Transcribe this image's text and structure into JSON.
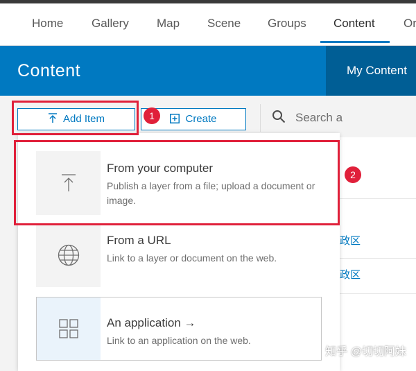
{
  "topnav": {
    "items": [
      {
        "label": "Home"
      },
      {
        "label": "Gallery"
      },
      {
        "label": "Map"
      },
      {
        "label": "Scene"
      },
      {
        "label": "Groups"
      },
      {
        "label": "Content",
        "active": true
      },
      {
        "label": "Or"
      }
    ]
  },
  "banner": {
    "title": "Content",
    "tab": "My Content"
  },
  "toolbar": {
    "add_item": "Add Item",
    "create": "Create",
    "search_placeholder": "Search a"
  },
  "background": {
    "row1": "政区",
    "row2": "政区"
  },
  "dropdown": {
    "options": [
      {
        "title": "From your computer",
        "desc": "Publish a layer from a file; upload a document or image.",
        "icon": "upload-icon"
      },
      {
        "title": "From a URL",
        "desc": "Link to a layer or document on the web.",
        "icon": "globe-icon"
      },
      {
        "title": "An application →",
        "desc": "Link to an application on the web.",
        "icon": "app-grid-icon"
      }
    ]
  },
  "annotations": {
    "marker1": "1",
    "marker2": "2"
  },
  "watermark": "知乎 @切切阿妹",
  "colors": {
    "accent": "#0079c1",
    "banner_tab": "#005e95",
    "highlight": "#e0203a"
  }
}
